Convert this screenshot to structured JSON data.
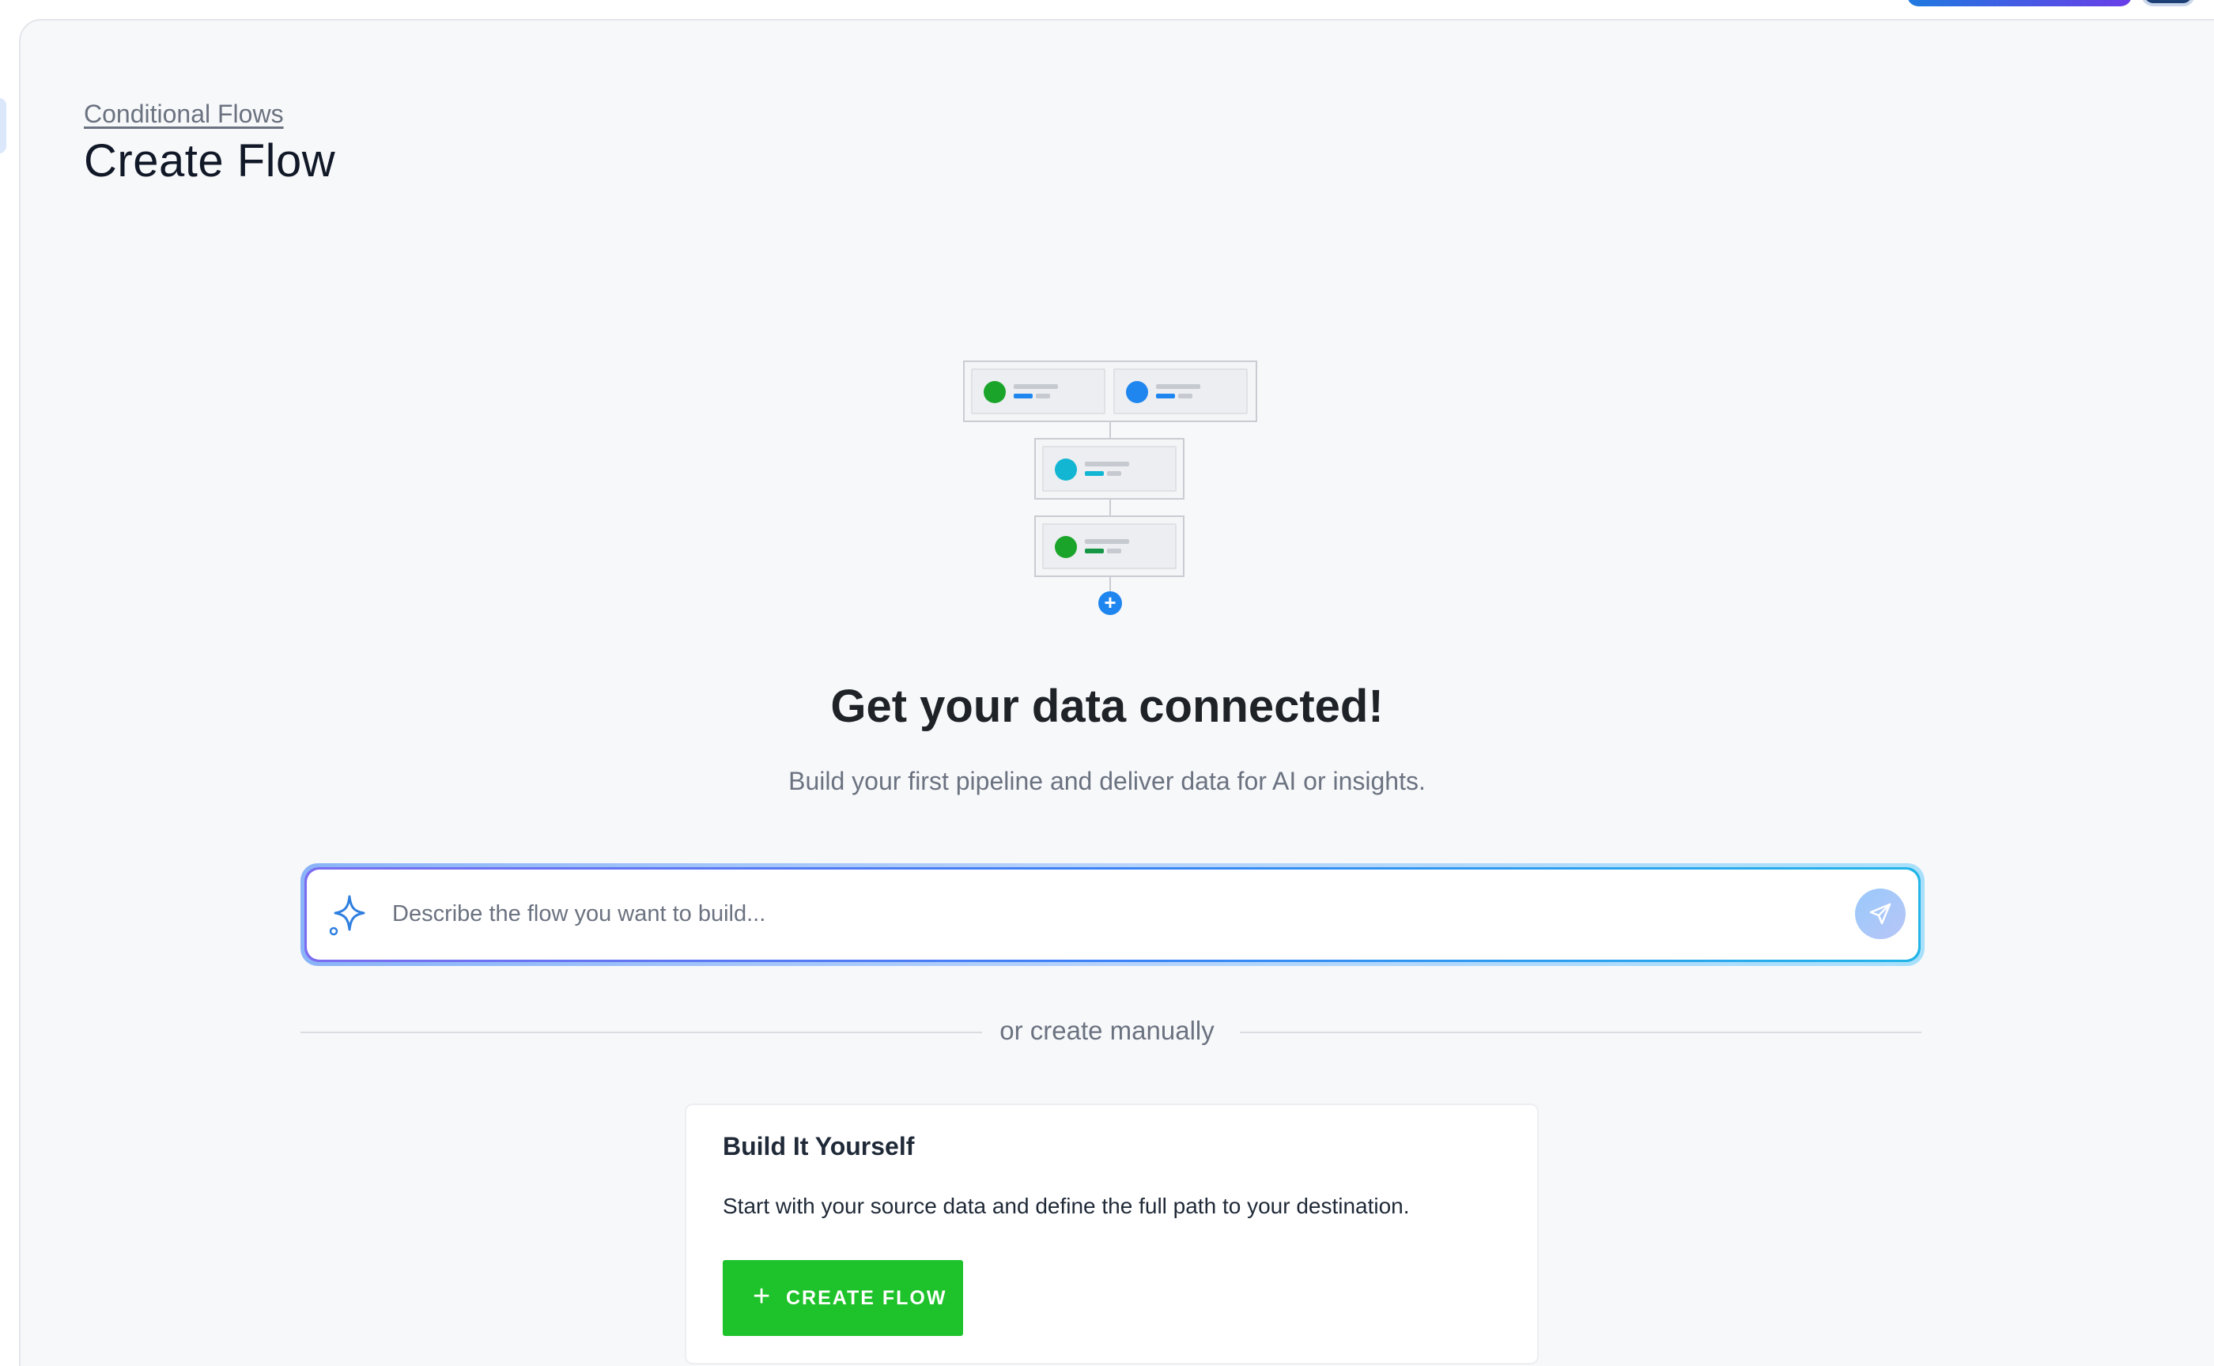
{
  "header": {
    "breadcrumb": "Conditional Flows",
    "title": "Create Flow"
  },
  "empty_state": {
    "headline": "Get your data connected!",
    "subline": "Build your first pipeline and deliver data for AI or insights."
  },
  "prompt": {
    "placeholder": "Describe the flow you want to build...",
    "value": ""
  },
  "divider": {
    "label": "or create manually"
  },
  "card": {
    "title": "Build It Yourself",
    "description": "Start with your source data and define the full path to your destination.",
    "button_label": "CREATE FLOW"
  },
  "icons": {
    "prompt_icon": "sparkle-icon",
    "send_icon": "send-icon",
    "button_icon": "plus-icon",
    "illustration_add": "plus-circle-icon"
  },
  "colors": {
    "accent_blue": "#1f86ef",
    "primary_green": "#1ec22a",
    "node_green": "#1aa52a",
    "node_blue": "#1f86ef",
    "node_cyan": "#12b6d3",
    "node_dark_green": "#149645"
  }
}
